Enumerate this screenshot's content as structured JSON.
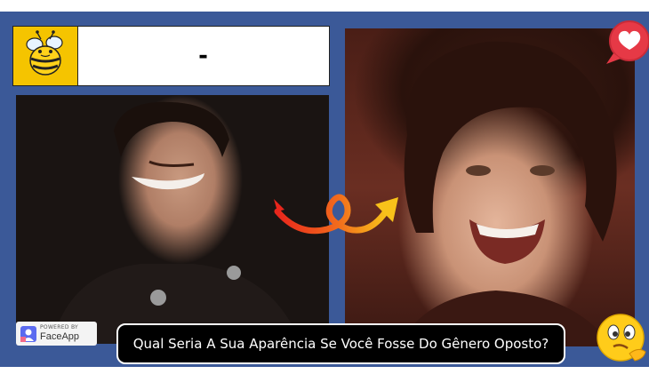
{
  "header": {
    "title": "-",
    "logo_icon": "bee-icon"
  },
  "badge": {
    "powered_label": "POWERED BY",
    "brand": "FaceApp"
  },
  "caption": {
    "text": "Qual Seria A Sua Aparência Se Você Fosse Do Gênero Oposto?"
  },
  "icons": {
    "heart": "heart-badge-icon",
    "emoji": "thinking-emoji-icon",
    "arrow": "curly-arrow-icon"
  },
  "colors": {
    "frame": "#3b5998",
    "logo_bg": "#f5c400",
    "heart_bg": "#e63946",
    "caption_bg": "#000000"
  }
}
